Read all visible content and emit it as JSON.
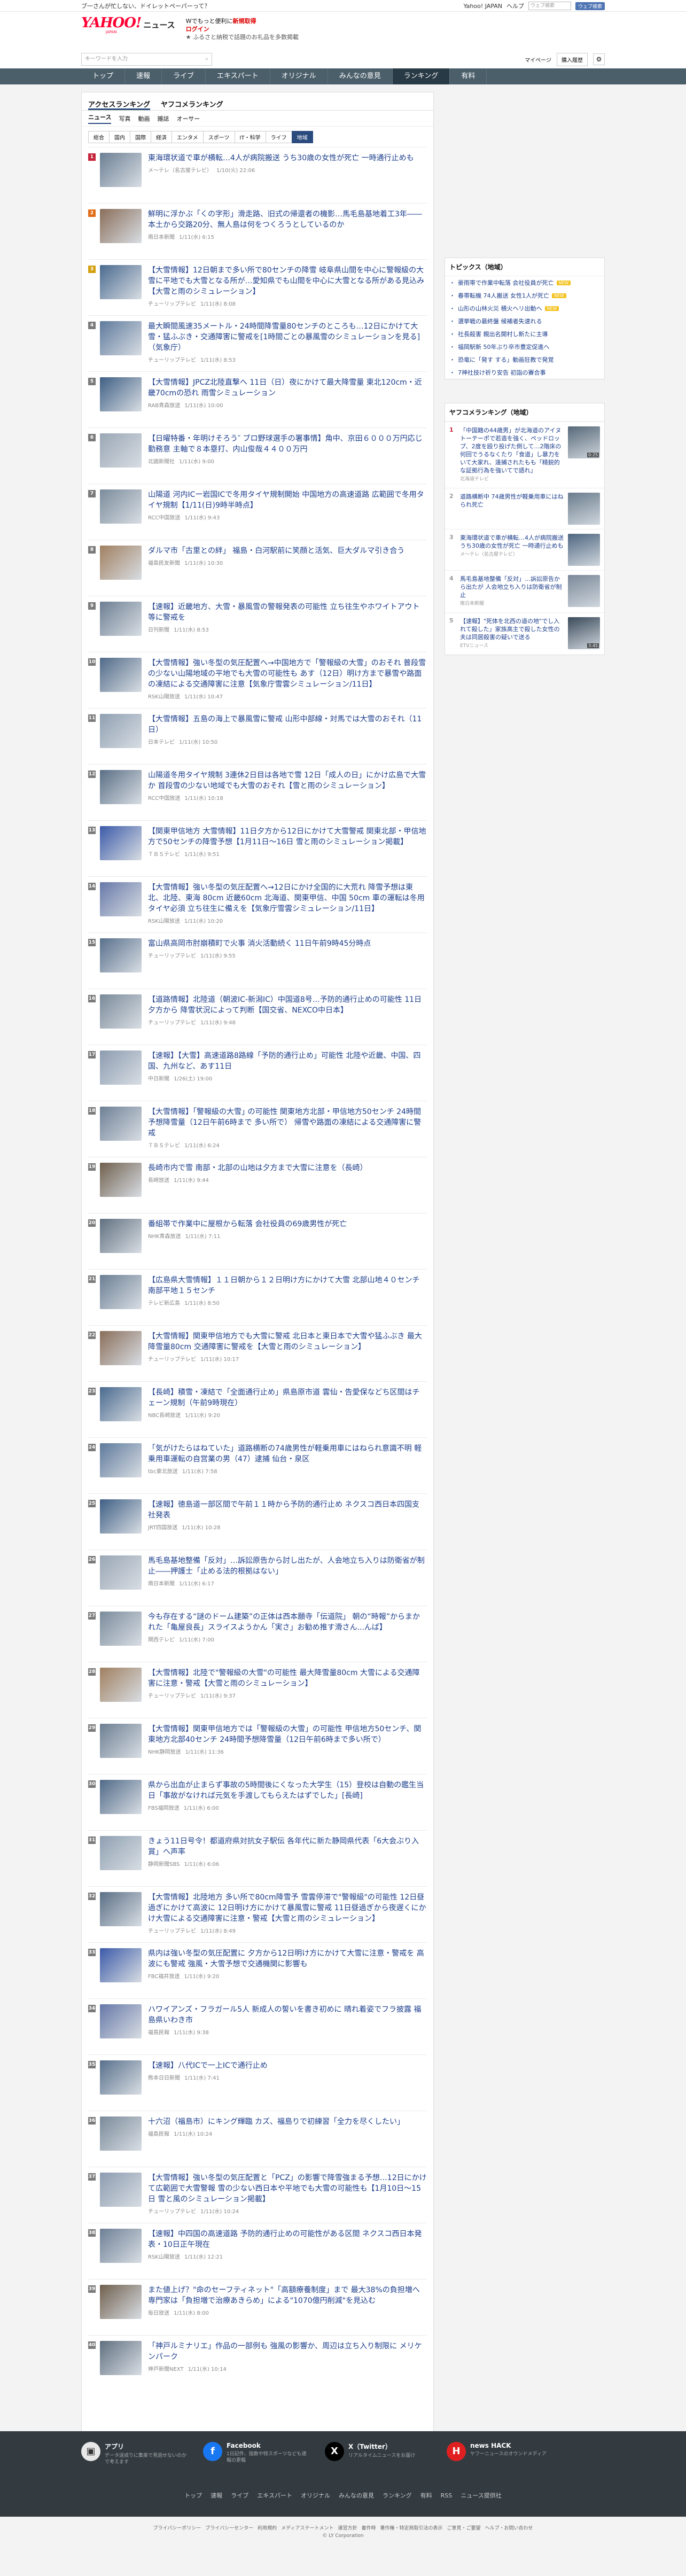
{
  "topbar": {
    "left": "ブ一さんが忙しない、ドイレットペーパーって？",
    "links": [
      "Yahoo! JAPAN",
      "ヘルプ"
    ],
    "search_placeholder": "ウェブ検索",
    "search_btn": "ウェブ検索"
  },
  "header": {
    "logo": "YAHOO!",
    "logo_sub": "JAPAN",
    "news": "ニュース",
    "promo1_pre": "Wでもっと便利に",
    "promo1_b": "新規取得",
    "promo2": "ログイン",
    "promo3": "ふるさと納税で話題のお礼品を多数掲載"
  },
  "searchbar": {
    "placeholder": "キーワードを入力",
    "mypage": "マイページ",
    "visitor": "購入履歴"
  },
  "gnav": [
    "トップ",
    "速報",
    "ライブ",
    "エキスパート",
    "オリジナル",
    "みんなの意見",
    "ランキング",
    "有料"
  ],
  "tabs": {
    "a": "アクセスランキング",
    "b": "ヤフコメランキング"
  },
  "cat1": [
    "ニュース",
    "写真",
    "動画",
    "雑誌",
    "オーサー"
  ],
  "cat2": [
    "総合",
    "国内",
    "国際",
    "経済",
    "エンタメ",
    "スポーツ",
    "IT・科学",
    "ライフ",
    "地域"
  ],
  "ranking": [
    {
      "n": "1",
      "title": "東海環状道で車が横転…4人が病院搬送 うち30歳の女性が死亡 一時通行止めも",
      "src": "メ～テレ（名古屋テレビ）",
      "time": "1/10(火) 22:06"
    },
    {
      "n": "2",
      "title": "鮮明に浮かぶ「くの字形」滑走路、旧式の帰還者の機影…馬毛島基地着工3年――本土から交路20分、無人島は何をつくろうとしているのか",
      "src": "南日本新聞",
      "time": "1/11(水) 6:15"
    },
    {
      "n": "3",
      "title": "【大雪情報】12日朝まで多い所で80センチの降雪 岐阜県山間を中心に警報級の大雪に平地でも大雪となる所が…愛知県でも山間を中心に大雪となる所がある見込み【大雪と雨のシミュレーション】",
      "src": "チューリップテレビ",
      "time": "1/11(水) 8:08"
    },
    {
      "n": "4",
      "title": "最大瞬間風速35メートル・24時間降雪量80センチのところも…12日にかけて大雪・猛ふぶき・交通障害に警戒を[1時間ごとの暴風雪のシミュレーションを見る]（気象庁）",
      "src": "チューリップテレビ",
      "time": "1/11(水) 8:53"
    },
    {
      "n": "5",
      "title": "【大雪情報】JPCZ北陸直撃へ 11日（日）夜にかけて最大降雪量 東北120cm・近畿70cmの恐れ 雨雪シミュレーション",
      "src": "RAB青森放送",
      "time": "1/11(水) 10:00"
    },
    {
      "n": "6",
      "title": "【日曜特番・年明けそろう″ ブロ野球選手の署事情】角中、京田６０００万円応じ勤務意 主軸で８本塁打、内山俊哉４４００万円",
      "src": "北國新聞社",
      "time": "1/11(水) 9:00"
    },
    {
      "n": "7",
      "title": "山陽道 河内ICー岩国ICで冬用タイヤ規制開始 中国地方の高速道路 広範囲で冬用タイヤ規制【1/11(日)9時半時点】",
      "src": "RCC中国放送",
      "time": "1/11(水) 9:43"
    },
    {
      "n": "8",
      "title": "ダルマ市「古里との絆」 福島・白河駅前に笑顔と活気、巨大ダルマ引き合う",
      "src": "福島民友新聞",
      "time": "1/11(水) 10:30"
    },
    {
      "n": "9",
      "title": "【速報】近畿地方、大雪・暴風雪の警報発表の可能性 立ち往生やホワイトアウト等に警戒を",
      "src": "日刊新聞",
      "time": "1/11(水) 8:53"
    },
    {
      "n": "10",
      "title": "【大雪情報】強い冬型の気圧配置へ→中国地方で「警報級の大雪」のおそれ 普段雪の少ない山陽地域の平地でも大雪の可能性も あす（12日）明け方まで暴雪や路面の凍結による交通障害に注意【気象庁雪雲シミュレーション/11日】",
      "src": "RSK山陽放送",
      "time": "1/11(水) 10:47"
    },
    {
      "n": "11",
      "title": "【大雪情報】五島の海上で暴風雪に警戒 山形中部線・対馬では大雪のおそれ（11日）",
      "src": "日本テレビ",
      "time": "1/11(水) 10:50"
    },
    {
      "n": "12",
      "title": "山陽道冬用タイヤ規制 3連休2日目は各地で雪 12日「成人の日」にかけ広島で大雪か 首段雪の少ない地域でも大雪のおそれ【雪と雨のシミュレーション】",
      "src": "RCC中国放送",
      "time": "1/11(水) 10:18"
    },
    {
      "n": "13",
      "title": "【関東甲信地方 大雪情報】11日夕方から12日にかけて大雪警戒 関東北部・甲信地方で50センチの降雪予想【1月11日～16日 雪と雨のシミュレーション掲載】",
      "src": "ＴＢＳテレビ",
      "time": "1/11(水) 9:51"
    },
    {
      "n": "14",
      "title": "【大雪情報】強い冬型の気圧配置へ→12日にかけ全国的に大荒れ 降雪予想は東北、北陸、東海 80cm 近畿60cm 北海道、関東甲信、中国 50cm 車の運転は冬用タイヤ必須 立ち往生に備えを【気象庁雪雲シミュレーション/11日】",
      "src": "RSK山陽放送",
      "time": "1/11(水) 10:20"
    },
    {
      "n": "15",
      "title": "富山県高岡市肘崩積町で火事 消火活動続く 11日午前9時45分時点",
      "src": "チューリップテレビ",
      "time": "1/11(水) 9:55"
    },
    {
      "n": "16",
      "title": "【道路情報】北陸道（朝波IC-新潟IC）中国道8号…予防的通行止めの可能性 11日夕方から 降雪状況によって判断【国交省、NEXCO中日本】",
      "src": "チューリップテレビ",
      "time": "1/11(水) 9:48"
    },
    {
      "n": "17",
      "title": "【速報】【大雪】高速道路8路線「予防的通行止め」可能性 北陸や近畿、中国、四国、九州など、あす11日",
      "src": "中日新聞",
      "time": "1/26(土) 19:00"
    },
    {
      "n": "18",
      "title": "【大雪情報】｢警報級の大雪｣ の可能性 関東地方北部・甲信地方50センチ 24時間予想降雪量（12日午前6時まで 多い所で） 帰雪や路面の凍結による交通障害に警戒",
      "src": "ＴＢＳテレビ",
      "time": "1/11(水) 6:24"
    },
    {
      "n": "19",
      "title": "長崎市内で雪 南部・北部の山地は夕方まで大雪に注意を（長崎）",
      "src": "長崎放送",
      "time": "1/11(水) 9:44"
    },
    {
      "n": "20",
      "title": "番組帯で作業中に屋根から転落 会社役員の69歳男性が死亡",
      "src": "NHK青森放送",
      "time": "1/11(水) 7:11"
    },
    {
      "n": "21",
      "title": "【広島県大雪情報】１１日朝から１２日明け方にかけて大雪 北部山地４０センチ 南部平地１５センチ",
      "src": "テレビ新広島",
      "time": "1/11(水) 8:50"
    },
    {
      "n": "22",
      "title": "【大雪情報】関東甲信地方でも大雪に警戒 北日本と東日本で大雪や猛ふぶき 最大降雪量80cm 交通障害に警戒を【大雪と雨のシミュレーション】",
      "src": "チューリップテレビ",
      "time": "1/11(水) 10:17"
    },
    {
      "n": "23",
      "title": "【長崎】積雪・凍結で「全面通行止め」県島原市道 雲仙・告愛保などち区間はチェーン規制（午前9時現在）",
      "src": "NBC長崎放送",
      "time": "1/11(水) 9:20"
    },
    {
      "n": "24",
      "title": "「気がけたらはねていた」道路横断の74歳男性が軽乗用車にはねられ意識不明 軽乗用車運転の自営業の男（47）逮捕 仙台・泉区",
      "src": "tbc東北放送",
      "time": "1/11(水) 7:58"
    },
    {
      "n": "25",
      "title": "【速報】徳島道一部区間で午前１１時から予防的通行止め ネクスコ西日本四国支社発表",
      "src": "JRT四国放送",
      "time": "1/11(水) 10:28"
    },
    {
      "n": "26",
      "title": "馬毛島基地整備「反対」…訴訟原告から討し出たが、人会地立ち入りは防衛省が制止――押護士「止める法的根拠はない」",
      "src": "南日本新聞",
      "time": "1/11(水) 6:17"
    },
    {
      "n": "27",
      "title": "今も存在する“謎のドーム建築”の正体は西本願寺「伝道院」 朝の“時報”からまかれた「亀屋良長」スライスようかん「実さ」お勧め推す滑さん...んば】",
      "src": "関西テレビ",
      "time": "1/11(水) 7:00"
    },
    {
      "n": "28",
      "title": "【大雪情報】北陸で\"警報級の大雪\"の可能性 最大降雪量80cm 大雪による交通障害に注意・警戒【大雪と雨のシミュレーション】",
      "src": "チューリップテレビ",
      "time": "1/11(水) 9:37"
    },
    {
      "n": "29",
      "title": "【大雪情報】関東甲信地方では「警報級の大雪」の可能性 甲信地方50センチ、関東地方北部40センチ 24時間予想降雪量（12日午前6時まで多い所で）",
      "src": "NHK静岡放送",
      "time": "1/11(水) 11:36"
    },
    {
      "n": "30",
      "title": "県から出血が止まらず事故の5時間後にくなった大学生（15）登校は自動の鑑生当日「事故がなければ元気を手渡してもらえたはずでした」[長崎]",
      "src": "FBS福岡放送",
      "time": "1/11(水) 6:00"
    },
    {
      "n": "31",
      "title": "きょう11日号令！都道府県対抗女子駅伝 各年代に新た静岡県代表「6大会ぶり入賞」へ声率",
      "src": "静岡新聞SBS",
      "time": "1/11(水) 6:06"
    },
    {
      "n": "32",
      "title": "【大雪情報】北陸地方 多い所で80cm降雪予 雪雲停滞で\"警報級\"の可能性 12日昼過ぎにかけて高波に 12日明け方にかけて暴風雪に警戒 11日昼過ぎから夜遅くにかけ大雪による交通障害に注意・警戒【大雪と雨のシミュレーション】",
      "src": "チューリップテレビ",
      "time": "1/11(水) 8:49"
    },
    {
      "n": "33",
      "title": "県内は強い冬型の気圧配置に 夕方から12日明け方にかけて大雪に注意・警戒を 高波にも警戒 強風・大雪予想で交通機関に影響も",
      "src": "FBC福井放送",
      "time": "1/11(水) 9:20"
    },
    {
      "n": "34",
      "title": "ハワイアンズ・フラガール5人 新成人の誓いを書き初めに 晴れ着姿でフラ披露 福島県いわき市",
      "src": "福島民報",
      "time": "1/11(水) 9:38"
    },
    {
      "n": "35",
      "title": "【速報】八代ICで一上ICで通行止め",
      "src": "熊本日日新聞",
      "time": "1/11(水) 7:41"
    },
    {
      "n": "36",
      "title": "十六沼（福島市）にキング輝臨 カズ、福島りで初練習「全力を尽くしたい」",
      "src": "福島民報",
      "time": "1/11(水) 10:24"
    },
    {
      "n": "37",
      "title": "【大雪情報】強い冬型の気圧配置と「PCZ」の影響で降雪強まる予想…12日にかけて広範囲で大雪警報 雪の少ない西日本や平地でも大雪の可能性も【1月10日～15日 雪と風のシミュレーション掲載】",
      "src": "チューリップテレビ",
      "time": "1/11(水) 10:24"
    },
    {
      "n": "38",
      "title": "【速報】中四国の高速道路 予防的通行止めの可能性がある区間 ネクスコ西日本発表・10日正午現在",
      "src": "RSK山陽放送",
      "time": "1/11(水) 12:21"
    },
    {
      "n": "39",
      "title": "また値上げ？\"命のセーフティネット\"「高額療養制度」まで 最大38%の負担増へ 専門家は「負担増で治療あきらめ」による\"1070億円削減\"を見込む",
      "src": "毎日放送",
      "time": "1/11(水) 8:00"
    },
    {
      "n": "40",
      "title": "「神戸ルミナリエ」作品の一部例も 強風の影響か、周辺は立ち入り制限に メリケンパーク",
      "src": "神戸新聞NEXT",
      "time": "1/11(水) 10:14"
    }
  ],
  "sidebar": {
    "topics_title": "トピックス（地域）",
    "topics": [
      {
        "t": "豪雨帯で作業中転落 会社役員が死亡",
        "b": "NEW"
      },
      {
        "t": "春帯転機 74人搬送 女性1人が死亡",
        "b": "NEW"
      },
      {
        "t": "山形の山林火災 積火ヘリ出動へ",
        "b": "NEW"
      },
      {
        "t": "選挙戦の最終盤 候補者失速れる",
        "b": ""
      },
      {
        "t": "社長殺害 親出名開村し新たに主導",
        "b": ""
      },
      {
        "t": "福岡駅新 50年ぶり卒市豊定促進へ",
        "b": ""
      },
      {
        "t": "恐竜に「発す する」動画狂教で発覚",
        "b": ""
      },
      {
        "t": "7神社技け祈り安告 初詣の賽合事",
        "b": ""
      }
    ],
    "acc_title": "ヤフコメランキング（地域）",
    "acc": [
      {
        "n": "1",
        "t": "「中国籍の44歳男」が北海道のアイヌトーテーポで若造を強く、ペッドロップ、2度を殴り投げた倒して…2階床の何回でうるなくたり「食道」し暴力をいて大家れ、遠捕されたもも「精鋭的な証拠行為を強いてで語れ」",
        "m": "北海道テレビ",
        "d": "0:25"
      },
      {
        "n": "2",
        "t": "道路横断中 74歳男性が軽乗用車にはねられ死亡",
        "m": "",
        "d": ""
      },
      {
        "n": "3",
        "t": "東海環状道で車が横転…4人が病院搬送 うち30歳の女性が死亡 一時通行止めも",
        "m": "メ～テレ（名古屋テレビ）",
        "d": ""
      },
      {
        "n": "4",
        "t": "馬毛島基地整備「反対」…訴訟原告から出たが 人会地立ち入りは防衛省が制止",
        "m": "南日本新聞",
        "d": ""
      },
      {
        "n": "5",
        "t": "【速報】\"死体を北西の道の地\"でし入れて殺した」家族高主で殺した女性の夫は同居殺害の疑いで送る",
        "m": "ETVニュース",
        "d": "3:45"
      }
    ]
  },
  "footer": {
    "cols": [
      {
        "t": "アプリ",
        "d": "データ送成りに集楽で見逃せないのかで考えます"
      },
      {
        "t": "Facebook",
        "d": "1日記件、指数や特スポーツなども速報の更報"
      },
      {
        "t": "X（Twitter）",
        "d": "リアルタイムニュースをお届け"
      },
      {
        "t": "news HACK",
        "d": "ヤフーニュースのオウンドメディア"
      }
    ],
    "nav": [
      "トップ",
      "速報",
      "ライブ",
      "エキスパート",
      "オリジナル",
      "みんなの意見",
      "ランキング",
      "有料",
      "RSS",
      "ニュース提供社"
    ],
    "links": [
      "プライバシーポリシー",
      "プライバシーセンター",
      "利用規約",
      "メディアステートメント",
      "運営方針",
      "書件時",
      "著作権・特定商取引法の表示",
      "ご意見・ご要望",
      "ヘルプ・お問い合わせ"
    ],
    "copy": "© LY Corporation"
  }
}
